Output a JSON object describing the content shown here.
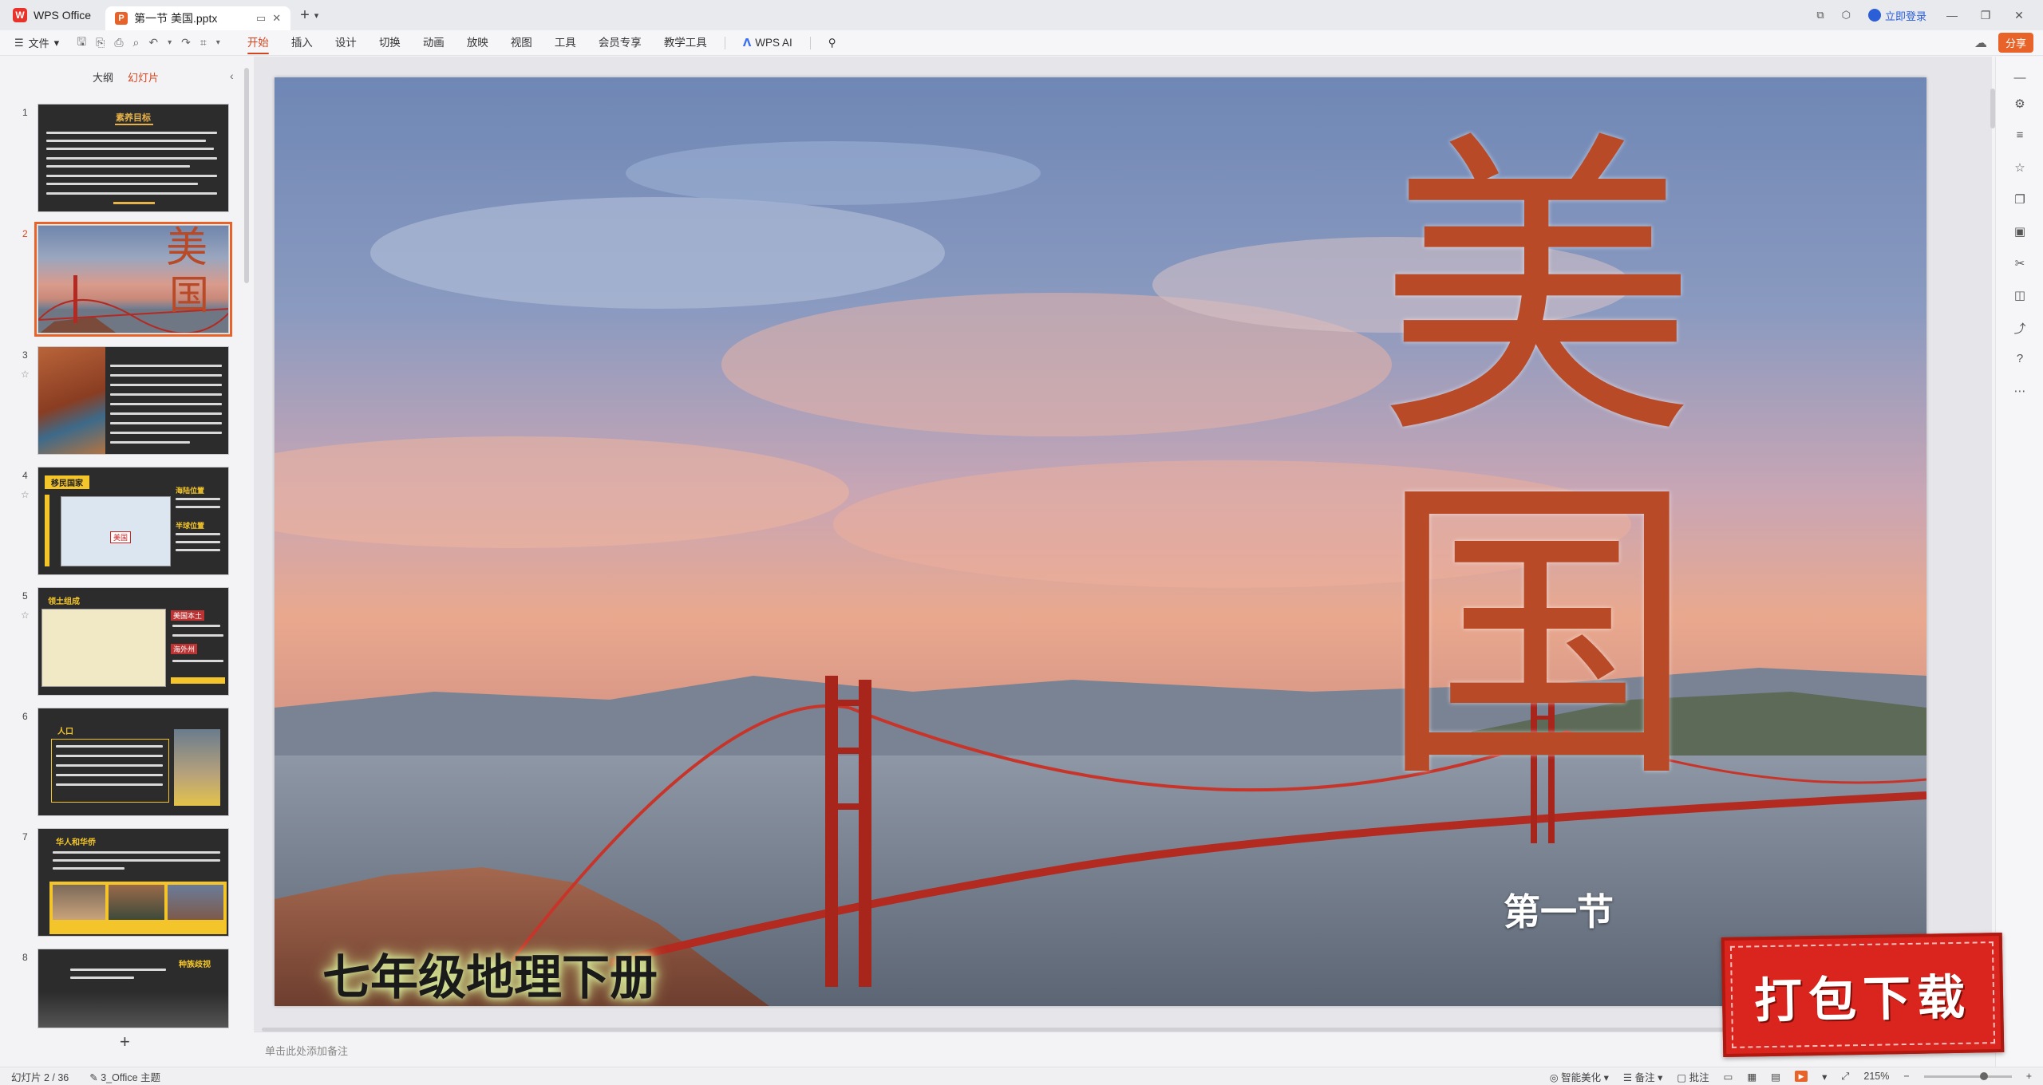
{
  "titlebar": {
    "app_name": "WPS Office",
    "doc_tab_title": "第一节 美国.pptx",
    "login_label": "立即登录"
  },
  "ribbon": {
    "file_label": "文件",
    "menu": [
      "开始",
      "插入",
      "设计",
      "切换",
      "动画",
      "放映",
      "视图",
      "工具",
      "会员专享",
      "教学工具"
    ],
    "active_menu": "开始",
    "ai_label": "WPS AI",
    "share_label": "分享"
  },
  "left_panel": {
    "tabs": [
      "大纲",
      "幻灯片"
    ],
    "active_tab": "幻灯片",
    "slide_numbers": [
      "1",
      "2",
      "3",
      "4",
      "5",
      "6",
      "7",
      "8"
    ],
    "selected_slide": 2,
    "thumb1_title": "素养目标",
    "thumb2_char1": "美",
    "thumb2_char2": "国",
    "thumb4_title": "移民国家",
    "thumb4_box1": "海陆位置",
    "thumb4_box2": "半球位置",
    "thumb4_label": "美国",
    "thumb5_title": "领土组成",
    "thumb5_box1": "美国本土",
    "thumb5_box2": "海外州",
    "thumb6_title": "人口",
    "thumb7_title": "华人和华侨",
    "thumb8_title": "种族歧视"
  },
  "slide": {
    "char1": "美",
    "char2": "国",
    "subtitle": "第一节",
    "grade": "七年级地理下册"
  },
  "notes": {
    "placeholder": "单击此处添加备注"
  },
  "statusbar": {
    "slide_counter": "幻灯片 2 / 36",
    "theme": "3_Office 主题",
    "beautify": "智能美化",
    "notes_label": "备注",
    "comment_label": "批注",
    "zoom": "215%"
  },
  "stamp": {
    "text": "打包下载"
  },
  "colors": {
    "accent": "#d4451f",
    "wps_red": "#e8322a",
    "ppt_orange": "#e8632a",
    "title_char": "#b84a28",
    "stamp_red": "#d9251d"
  }
}
